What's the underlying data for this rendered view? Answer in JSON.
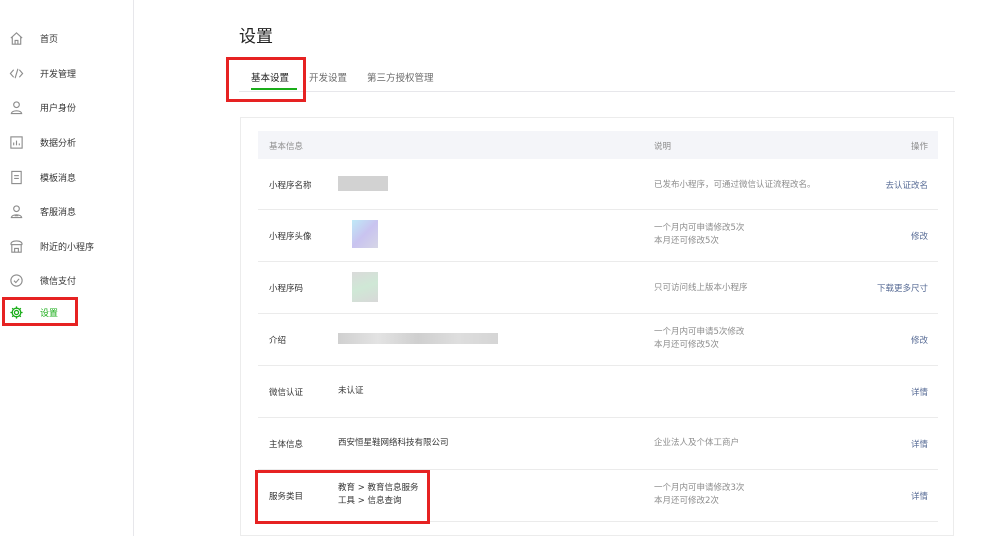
{
  "sidebar": {
    "items": [
      {
        "label": "首页",
        "icon": "home-icon"
      },
      {
        "label": "开发管理",
        "icon": "code-icon"
      },
      {
        "label": "用户身份",
        "icon": "user-icon"
      },
      {
        "label": "数据分析",
        "icon": "chart-icon"
      },
      {
        "label": "模板消息",
        "icon": "message-template-icon"
      },
      {
        "label": "客服消息",
        "icon": "customer-service-icon"
      },
      {
        "label": "附近的小程序",
        "icon": "nearby-store-icon"
      },
      {
        "label": "微信支付",
        "icon": "payment-icon"
      },
      {
        "label": "设置",
        "icon": "gear-icon"
      }
    ],
    "active_index": 8
  },
  "main": {
    "title": "设置",
    "tabs": [
      {
        "label": "基本设置"
      },
      {
        "label": "开发设置"
      },
      {
        "label": "第三方授权管理"
      }
    ],
    "active_tab": 0
  },
  "table": {
    "headers": {
      "info": "基本信息",
      "desc": "说明",
      "op": "操作"
    },
    "rows": [
      {
        "label": "小程序名称",
        "value": "",
        "desc": "已发布小程序，可通过微信认证流程改名。",
        "op": "去认证改名"
      },
      {
        "label": "小程序头像",
        "value": "",
        "desc": "一个月内可申请修改5次",
        "desc2": "本月还可修改5次",
        "op": "修改"
      },
      {
        "label": "小程序码",
        "value": "",
        "desc": "只可访问线上版本小程序",
        "op": "下载更多尺寸"
      },
      {
        "label": "介绍",
        "value": "",
        "desc": "一个月内可申请5次修改",
        "desc2": "本月还可修改5次",
        "op": "修改"
      },
      {
        "label": "微信认证",
        "value": "未认证",
        "desc": "",
        "op": "详情"
      },
      {
        "label": "主体信息",
        "value": "西安恒星鞋网络科技有限公司",
        "desc": "企业法人及个体工商户",
        "op": "详情"
      },
      {
        "label": "服务类目",
        "value": "教育 > 教育信息服务",
        "value2": "工具 > 信息查询",
        "desc": "一个月内可申请修改3次",
        "desc2": "本月还可修改2次",
        "op": "详情"
      }
    ]
  },
  "colors": {
    "accent": "#1aad19",
    "link": "#576b95",
    "highlight": "#e62222"
  }
}
